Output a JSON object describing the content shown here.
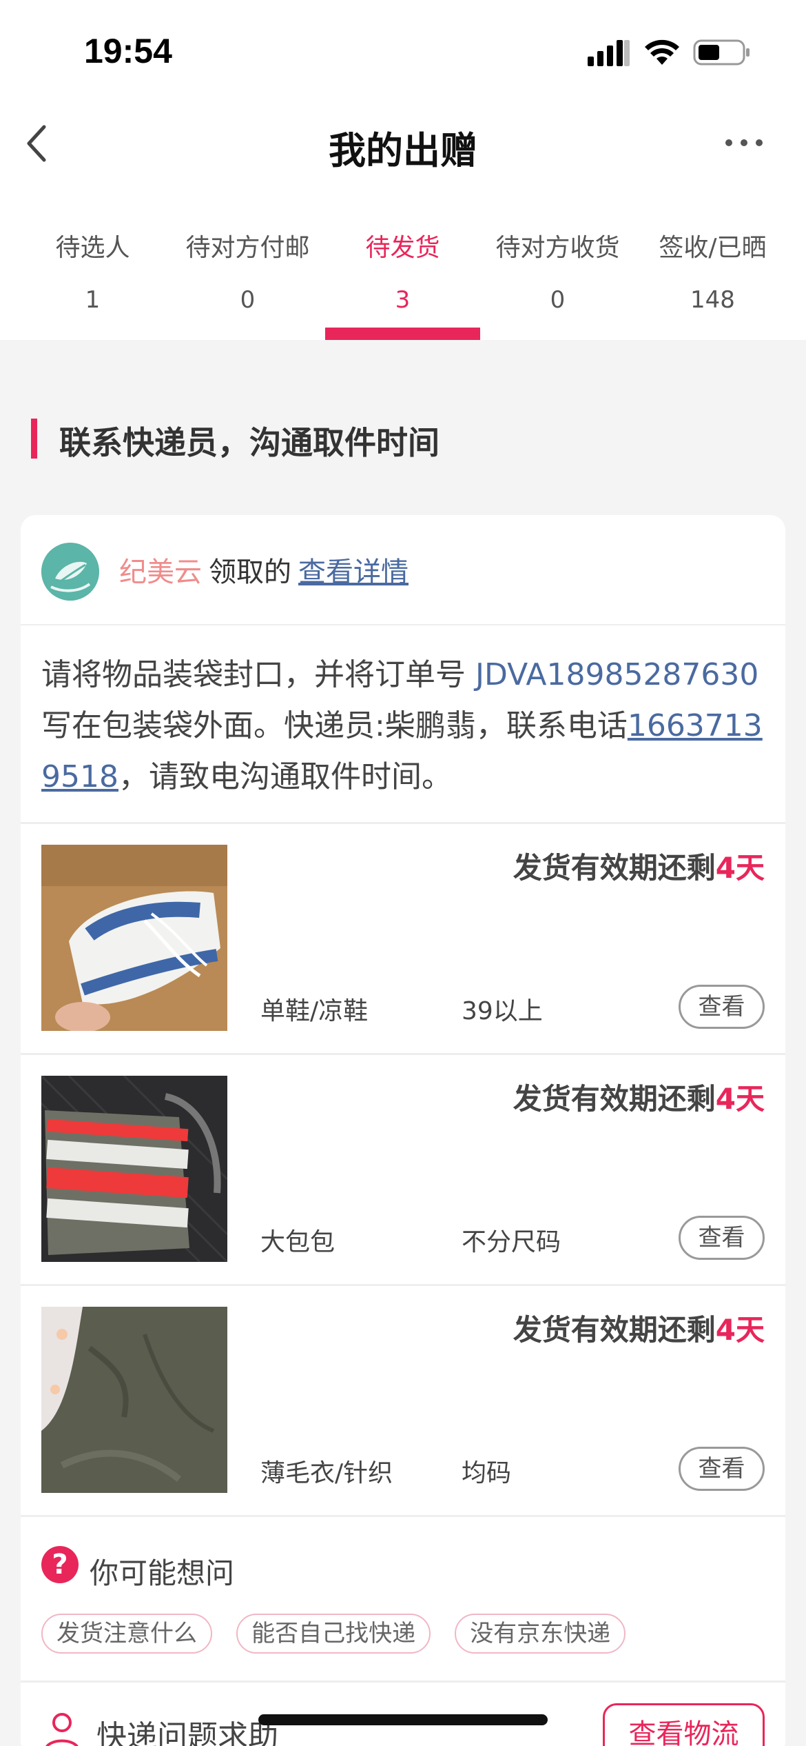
{
  "status_bar": {
    "time": "19:54"
  },
  "nav": {
    "title": "我的出赠",
    "back_icon": "chevron-left-icon",
    "more_icon": "more-horizontal-icon"
  },
  "tabs": [
    {
      "label": "待选人",
      "count": "1",
      "active": false
    },
    {
      "label": "待对方付邮",
      "count": "0",
      "active": false
    },
    {
      "label": "待发货",
      "count": "3",
      "active": true
    },
    {
      "label": "待对方收货",
      "count": "0",
      "active": false
    },
    {
      "label": "签收/已晒",
      "count": "148",
      "active": false
    }
  ],
  "section": {
    "title": "联系快递员，沟通取件时间"
  },
  "card": {
    "recipient_name": "纪美云",
    "claim_text": "领取的",
    "details_link": "查看详情",
    "instructions": {
      "part1": "请将物品装袋封口，并将订单号",
      "order_no": "JDVA18985287630",
      "part2": "写在包装袋外面。快递员:柴鹏翡，联系电话",
      "phone": "16637139518",
      "part3": "，请致电沟通取件时间。"
    },
    "items": [
      {
        "deadline_prefix": "发货有效期还剩",
        "deadline_days": "4天",
        "category": "单鞋/凉鞋",
        "size": "39以上",
        "view_label": "查看"
      },
      {
        "deadline_prefix": "发货有效期还剩",
        "deadline_days": "4天",
        "category": "大包包",
        "size": "不分尺码",
        "view_label": "查看"
      },
      {
        "deadline_prefix": "发货有效期还剩",
        "deadline_days": "4天",
        "category": "薄毛衣/针织",
        "size": "均码",
        "view_label": "查看"
      }
    ],
    "faq": {
      "icon": "?",
      "title": "你可能想问",
      "chips": [
        "发货注意什么",
        "能否自己找快递",
        "没有京东快递"
      ]
    },
    "help": {
      "label": "快递问题求助",
      "button": "查看物流"
    }
  },
  "colors": {
    "accent": "#e8265a",
    "link": "#4a6aa0",
    "recipient": "#f08c8c",
    "background": "#f4f4f4"
  }
}
